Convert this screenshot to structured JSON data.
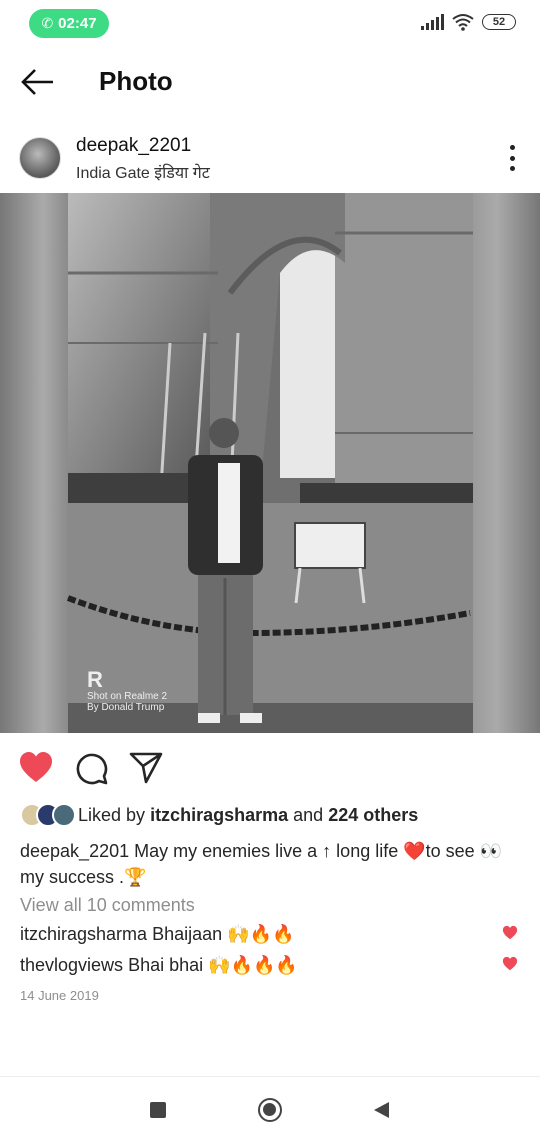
{
  "status_bar": {
    "call_time": "02:47",
    "battery": "52",
    "icons": [
      "phone-icon",
      "signal-icon",
      "wifi-icon",
      "battery-icon"
    ]
  },
  "header": {
    "title": "Photo",
    "back_icon": "arrow-left-icon"
  },
  "post": {
    "username": "deepak_2201",
    "location": "India Gate   इंडिया गेट",
    "more_icon": "more-vertical-icon",
    "photo_watermark": {
      "logo": "R",
      "line1": "Shot on Realme 2",
      "line2": "By Donald Trump"
    },
    "actions": {
      "like_icon": "heart-filled-icon",
      "comment_icon": "comment-icon",
      "share_icon": "send-icon",
      "like_color": "#ed4956"
    },
    "likes": {
      "prefix": "Liked by",
      "user": "itzchiragsharma",
      "middle": "and",
      "others": "224 others"
    },
    "caption": {
      "user": "deepak_2201",
      "text": "May my enemies live a ↑ long life ❤️to see 👀 my success .🏆"
    },
    "view_comments": "View all 10 comments",
    "comments": [
      {
        "user": "itzchiragsharma",
        "text": "Bhaijaan 🙌🔥🔥"
      },
      {
        "user": "thevlogviews",
        "text": "Bhai bhai 🙌🔥🔥🔥"
      }
    ],
    "date": "14 June 2019"
  },
  "nav_bar": {
    "icons": [
      "recents-square-icon",
      "home-circle-icon",
      "back-triangle-icon"
    ]
  }
}
